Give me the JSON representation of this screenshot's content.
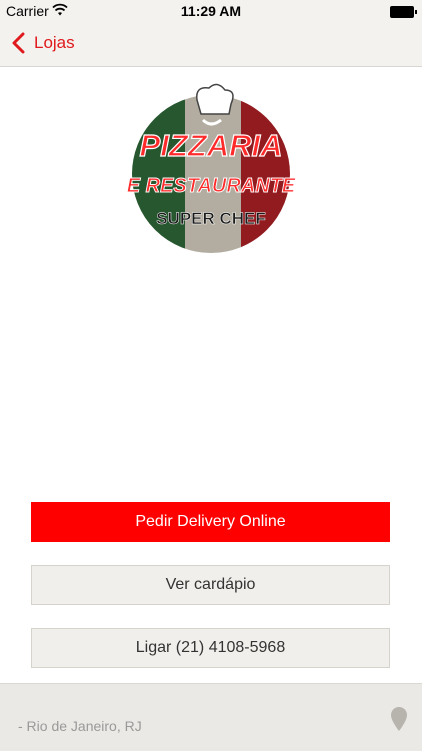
{
  "status_bar": {
    "carrier": "Carrier",
    "time": "11:29 AM"
  },
  "nav": {
    "back_label": "Lojas"
  },
  "logo": {
    "line1": "PIZZARIA",
    "line2": "E RESTAURANTE",
    "line3": "SUPER CHEF"
  },
  "buttons": {
    "delivery": "Pedir Delivery Online",
    "menu": "Ver cardápio",
    "call": "Ligar (21) 4108-5968"
  },
  "footer": {
    "address": "- Rio de Janeiro, RJ"
  },
  "colors": {
    "accent": "#ff0000",
    "nav_tint": "#e0191c"
  }
}
